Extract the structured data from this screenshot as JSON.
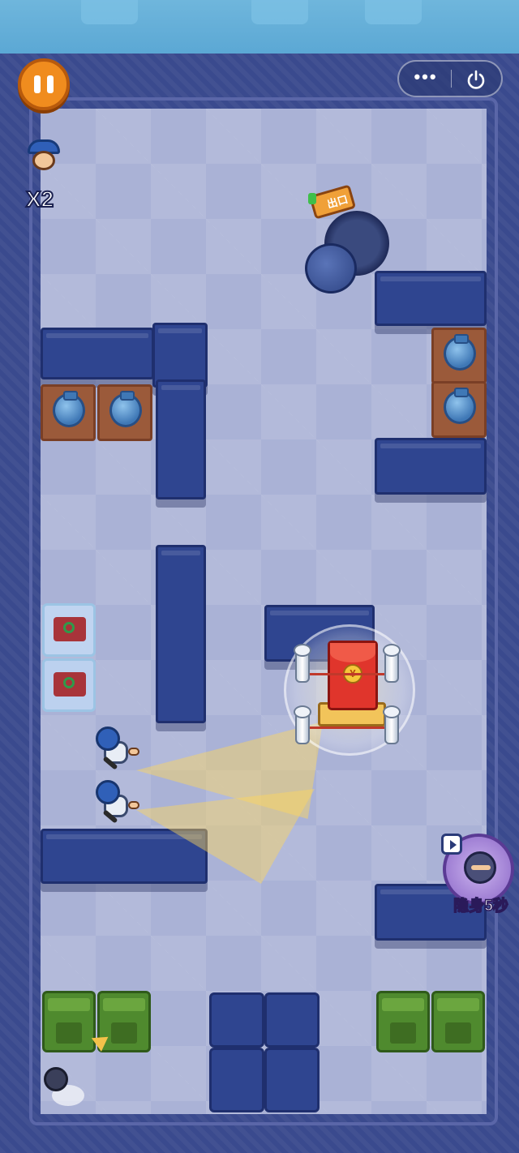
{
  "hud": {
    "pause_label": "Pause",
    "lives_count": "X2",
    "menu_more": "•••",
    "menu_power": "Power"
  },
  "exit": {
    "sign_text": "出口"
  },
  "treasure": {
    "coin_symbol": "¥"
  },
  "skill": {
    "label": "隐身5秒"
  },
  "colors": {
    "floor": "#aab2d6",
    "wall": "#2f4590",
    "frame": "#3a4a8e",
    "pause_button": "#f08c1e",
    "red_envelope": "#e0352c",
    "vision_cone": "#ffd75a",
    "trash_bin": "#4f8a2e"
  },
  "icons": [
    "pause-icon",
    "more-icon",
    "power-icon",
    "police-head-icon",
    "exit-sign-icon",
    "red-envelope-icon",
    "coin-icon",
    "guard-icon",
    "thief-icon",
    "vase-icon",
    "video-icon"
  ]
}
